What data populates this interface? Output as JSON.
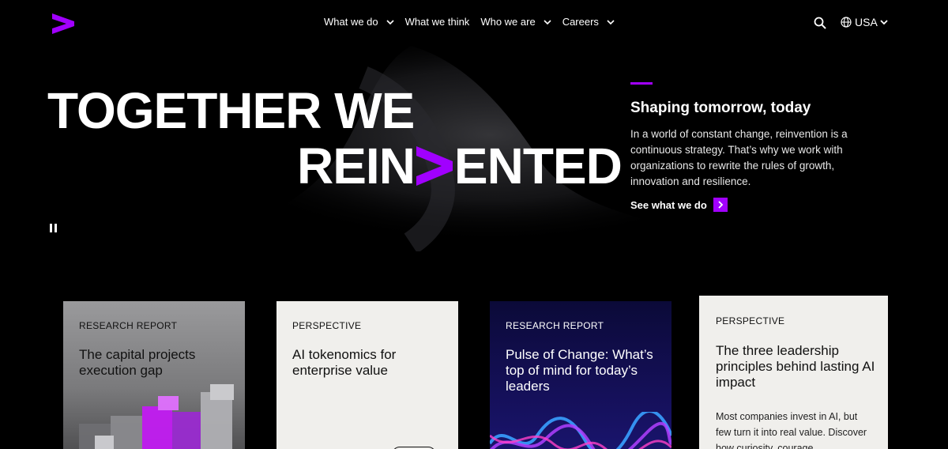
{
  "header": {
    "logo": "accenture-greater-than-logo",
    "nav": [
      {
        "label": "What we do",
        "has_menu": true
      },
      {
        "label": "What we think",
        "has_menu": false
      },
      {
        "label": "Who we are",
        "has_menu": true
      },
      {
        "label": "Careers",
        "has_menu": true
      }
    ],
    "search_icon": "search-icon",
    "region": {
      "label": "USA",
      "icon": "globe-icon"
    }
  },
  "hero": {
    "headline_line1": "TOGETHER WE",
    "headline_line2_start": "REIN",
    "headline_line2_end": "ENTED",
    "title": "Shaping tomorrow, today",
    "body": "In a world of constant change, reinvention is a continuous strategy. That’s why we work with organizations to rewrite the rules of growth, innovation and resilience.",
    "cta": "See what we do"
  },
  "cards": [
    {
      "label": "RESEARCH REPORT",
      "title": "The capital projects execution gap"
    },
    {
      "label": "PERSPECTIVE",
      "title": "AI tokenomics for enterprise value"
    },
    {
      "label": "RESEARCH REPORT",
      "title": "Pulse of Change: What’s top of mind for today’s leaders"
    },
    {
      "label": "PERSPECTIVE",
      "title": "The three leadership principles behind lasting AI impact",
      "description": "Most companies invest in AI, but few turn it into real value. Discover how curiosity, courage,"
    }
  ],
  "colors": {
    "brand_purple": "#a100ff",
    "background": "#000000",
    "card_light": "#f0efec"
  }
}
